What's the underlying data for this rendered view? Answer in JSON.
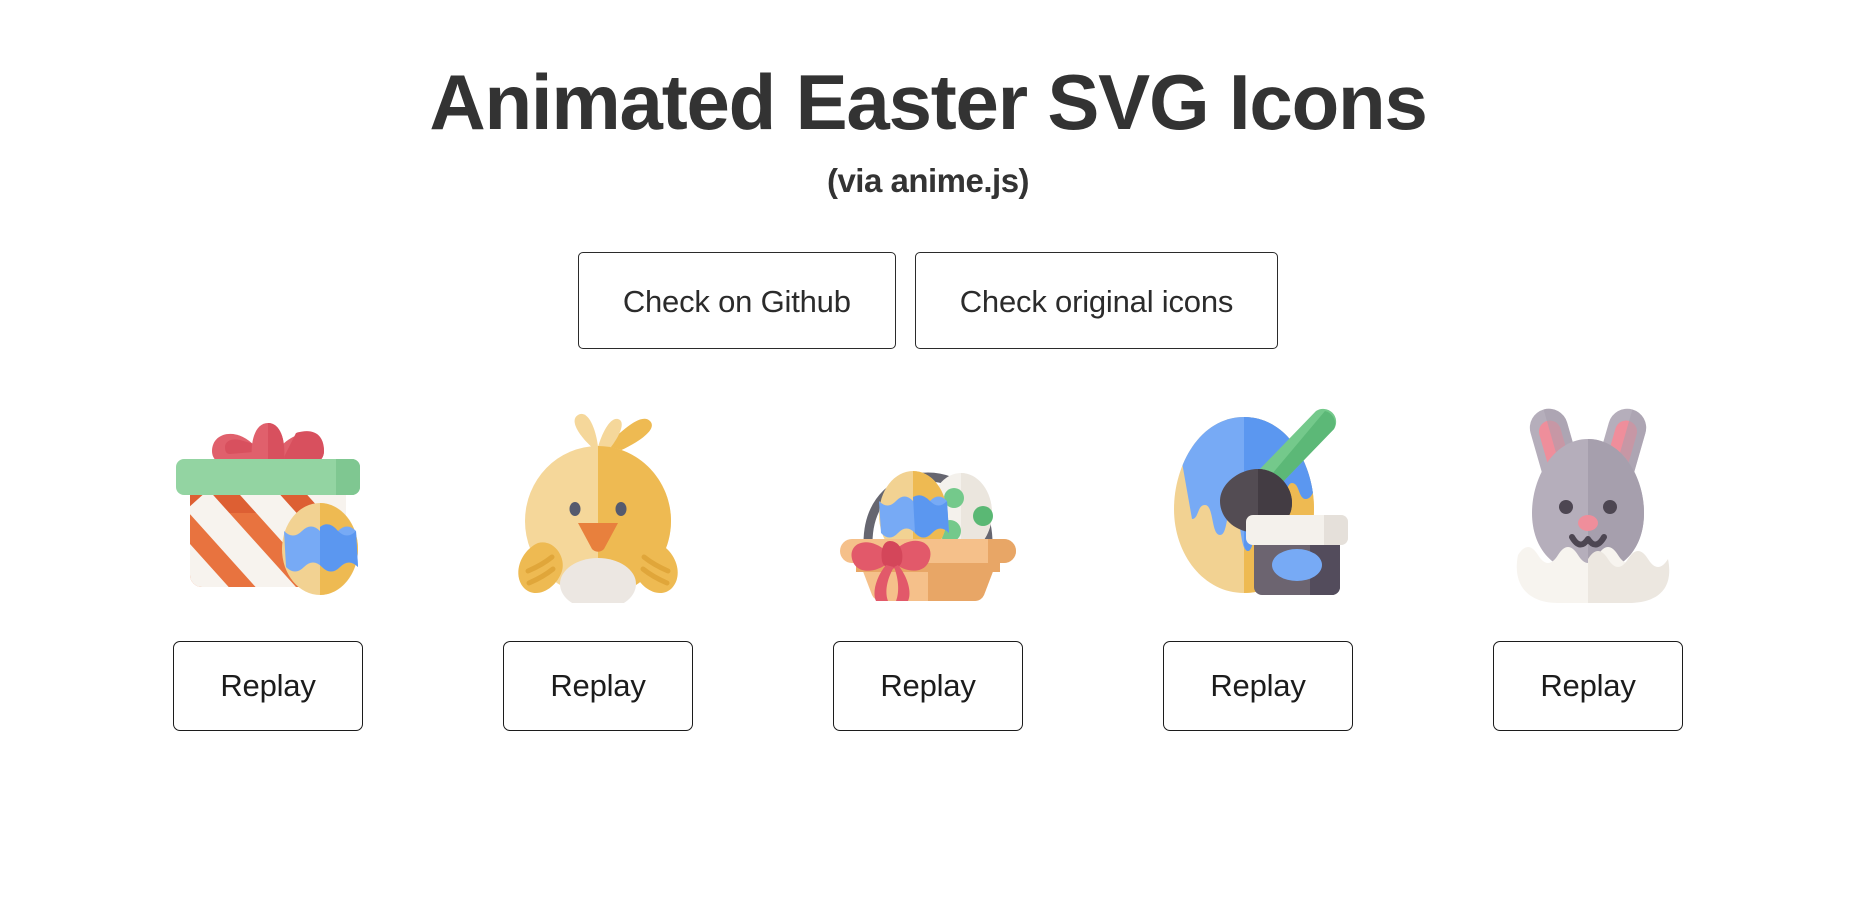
{
  "header": {
    "title": "Animated Easter SVG Icons",
    "subtitle": "(via anime.js)"
  },
  "links": [
    {
      "label": "Check on Github",
      "name": "check-on-github-button"
    },
    {
      "label": "Check original icons",
      "name": "check-original-icons-button"
    }
  ],
  "icons": [
    {
      "name": "gift-box-icon",
      "alt": "Gift box with bow and egg",
      "replay_label": "Replay",
      "colors": {
        "bow": "#e0606c",
        "bow_dark": "#d8505e",
        "lid": "#93d4a2",
        "lid_dark": "#7fc791",
        "box": "#e8733f",
        "box_dark": "#dd5f33",
        "stripe": "#f7f3ee",
        "egg_yellow": "#f2d292",
        "egg_yellow_dark": "#eeba52",
        "egg_blue": "#77aaf5",
        "egg_blue_dark": "#5b97f0"
      }
    },
    {
      "name": "chick-icon",
      "alt": "Baby chick",
      "replay_label": "Replay",
      "colors": {
        "body": "#f5d79a",
        "body_dark": "#eeba52",
        "beak": "#e8803d",
        "eye": "#555a6e",
        "belly": "#ece7e2"
      }
    },
    {
      "name": "easter-basket-icon",
      "alt": "Easter basket with eggs",
      "replay_label": "Replay",
      "colors": {
        "handle": "#666670",
        "basket": "#f5c08a",
        "basket_rim": "#f0b97c",
        "basket_dark": "#e8a666",
        "bow": "#e2596a",
        "bow_dark": "#d4465a",
        "egg_blue": "#77aaf5",
        "egg_blue_dark": "#5b97f0",
        "egg_yellow": "#f2d292",
        "egg_yellow_dark": "#eeba52",
        "egg_white": "#f4f1ec",
        "egg_dots": "#74c98b"
      }
    },
    {
      "name": "painted-egg-icon",
      "alt": "Egg being painted with brush and paint jar",
      "replay_label": "Replay",
      "colors": {
        "egg": "#f2d292",
        "egg_dark": "#eeba52",
        "paint_blue": "#77aaf5",
        "paint_blue_dark": "#5b97f0",
        "brush_handle": "#74c98b",
        "brush_handle_dark": "#5cb877",
        "brush_head": "#534c53",
        "brush_head_dark": "#433c43",
        "jar": "#6c6470",
        "jar_dark": "#534c5c",
        "jar_lid": "#f4f1ec",
        "jar_lid_dark": "#e5e0da",
        "jar_label": "#77aaf5"
      }
    },
    {
      "name": "bunny-in-egg-icon",
      "alt": "Bunny hatching from egg",
      "replay_label": "Replay",
      "colors": {
        "fur": "#b5aebb",
        "fur_dark": "#a69fad",
        "ear_inner": "#ef8e9b",
        "nose": "#ef8e9b",
        "eye": "#4d4652",
        "shell": "#f7f4ef",
        "shell_dark": "#ece7e0"
      }
    }
  ]
}
